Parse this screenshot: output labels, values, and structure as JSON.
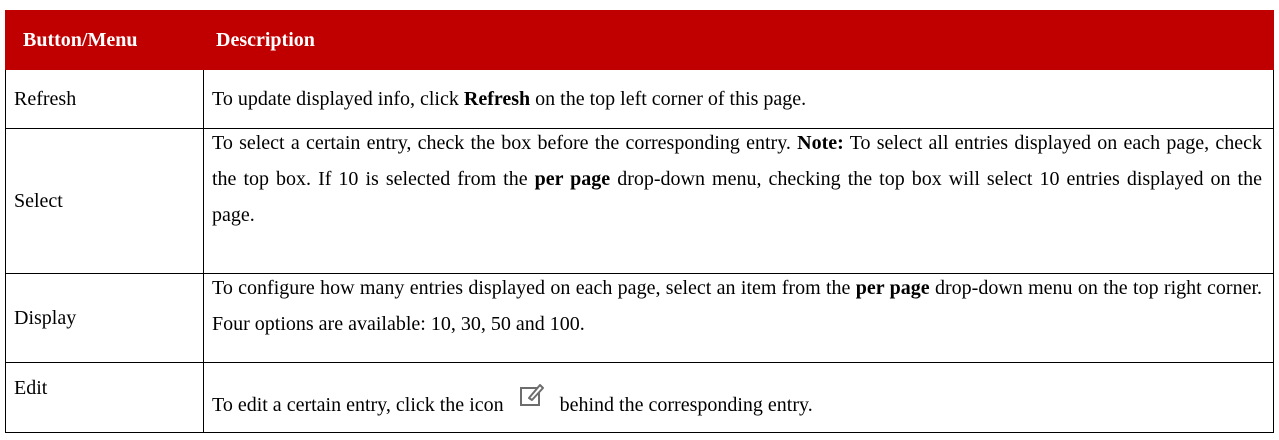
{
  "table": {
    "headers": [
      "Button/Menu",
      "Description"
    ],
    "rows": [
      {
        "name": "Refresh",
        "desc": [
          "To update displayed info, click ",
          "Refresh",
          " on the top left corner of this page."
        ]
      },
      {
        "name": "Select",
        "desc": [
          "To select a certain entry, check the box before the corresponding entry. ",
          "Note:",
          " To select all entries displayed on each page, check the top box. If 10 is selected from the ",
          "per page",
          " drop-down menu, checking the top box will select 10 entries displayed on the page."
        ]
      },
      {
        "name": "Display",
        "desc": [
          "To configure how many entries displayed on each page, select an item from the ",
          "per page",
          " drop-down menu on the top right corner. Four options are available: 10, 30, 50 and 100."
        ]
      },
      {
        "name": "Edit",
        "desc": [
          "To edit a certain entry, click the icon",
          "behind the corresponding entry."
        ],
        "icon": "edit-icon"
      }
    ]
  },
  "colors": {
    "header_bg": "#c00000",
    "header_text": "#ffffff",
    "icon_stroke": "#6d6d6d"
  }
}
